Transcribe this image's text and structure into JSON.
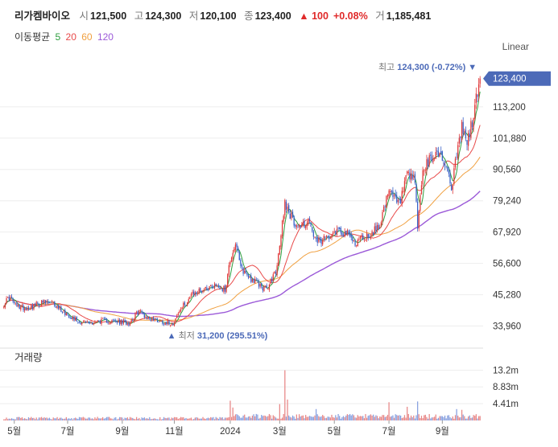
{
  "header": {
    "name": "리가켐바이오",
    "open_label": "시",
    "open": "121,500",
    "high_label": "고",
    "high": "124,300",
    "low_label": "저",
    "low": "120,100",
    "close_label": "종",
    "close": "123,400",
    "change": "▲ 100",
    "change_pct": "+0.08%",
    "volume_label": "거",
    "volume": "1,185,481"
  },
  "ma_legend": {
    "label": "이동평균",
    "items": [
      {
        "period": "5",
        "color": "#2e9e3f"
      },
      {
        "period": "20",
        "color": "#e84a4a"
      },
      {
        "period": "60",
        "color": "#f0a040"
      },
      {
        "period": "120",
        "color": "#9b59d8"
      }
    ]
  },
  "scale_mode": "Linear",
  "colors": {
    "up": "#e03a3a",
    "down": "#3a62c8",
    "current_badge": "#4c6ab8",
    "grid": "#eeeeee"
  },
  "chart_data": {
    "type": "candlestick",
    "ylim": [
      28300,
      130000
    ],
    "y_ticks": [
      "123,400",
      "113,200",
      "101,880",
      "90,560",
      "79,240",
      "67,920",
      "56,600",
      "45,280",
      "33,960"
    ],
    "y_tick_values": [
      123400,
      113200,
      101880,
      90560,
      79240,
      67920,
      56600,
      45280,
      33960
    ],
    "x_ticks": [
      "5월",
      "7월",
      "9월",
      "11월",
      "2024",
      "3월",
      "5월",
      "7월",
      "9월"
    ],
    "x_tick_index": [
      8,
      49,
      91,
      131,
      174,
      212,
      254,
      296,
      337
    ],
    "high_annotation": {
      "label": "최고",
      "value": "124,300 (-0.72%)",
      "price": 124300
    },
    "low_annotation": {
      "label": "최저",
      "value": "31,200 (295.51%)",
      "price": 31200
    },
    "current_price": "123,400",
    "close_anchors": [
      [
        0,
        42000
      ],
      [
        4,
        44500
      ],
      [
        10,
        41000
      ],
      [
        18,
        40500
      ],
      [
        30,
        42500
      ],
      [
        38,
        42000
      ],
      [
        48,
        38500
      ],
      [
        58,
        35500
      ],
      [
        66,
        35000
      ],
      [
        76,
        36000
      ],
      [
        86,
        35500
      ],
      [
        96,
        35000
      ],
      [
        104,
        39500
      ],
      [
        110,
        37000
      ],
      [
        122,
        35500
      ],
      [
        130,
        35000
      ],
      [
        136,
        40000
      ],
      [
        144,
        45000
      ],
      [
        152,
        47000
      ],
      [
        162,
        49000
      ],
      [
        170,
        47000
      ],
      [
        174,
        58000
      ],
      [
        178,
        64000
      ],
      [
        182,
        55000
      ],
      [
        190,
        51000
      ],
      [
        196,
        49000
      ],
      [
        202,
        47000
      ],
      [
        210,
        55000
      ],
      [
        216,
        79000
      ],
      [
        222,
        72000
      ],
      [
        228,
        70000
      ],
      [
        234,
        72000
      ],
      [
        240,
        64000
      ],
      [
        246,
        65000
      ],
      [
        252,
        68000
      ],
      [
        258,
        69000
      ],
      [
        264,
        67000
      ],
      [
        270,
        64000
      ],
      [
        276,
        66000
      ],
      [
        282,
        67000
      ],
      [
        288,
        70000
      ],
      [
        296,
        82000
      ],
      [
        304,
        78000
      ],
      [
        310,
        88000
      ],
      [
        316,
        86000
      ],
      [
        318,
        70000
      ],
      [
        322,
        90000
      ],
      [
        328,
        94000
      ],
      [
        334,
        97000
      ],
      [
        340,
        92000
      ],
      [
        344,
        84000
      ],
      [
        348,
        95000
      ],
      [
        352,
        106000
      ],
      [
        356,
        100000
      ],
      [
        360,
        108000
      ],
      [
        364,
        118000
      ],
      [
        366,
        123400
      ]
    ],
    "volume": {
      "ylim": [
        0,
        15000000
      ],
      "y_ticks": [
        "13.2m",
        "8.83m",
        "4.41m"
      ],
      "y_tick_values": [
        13200000,
        8830000,
        4410000
      ]
    }
  },
  "volume_panel": {
    "title": "거래량"
  }
}
